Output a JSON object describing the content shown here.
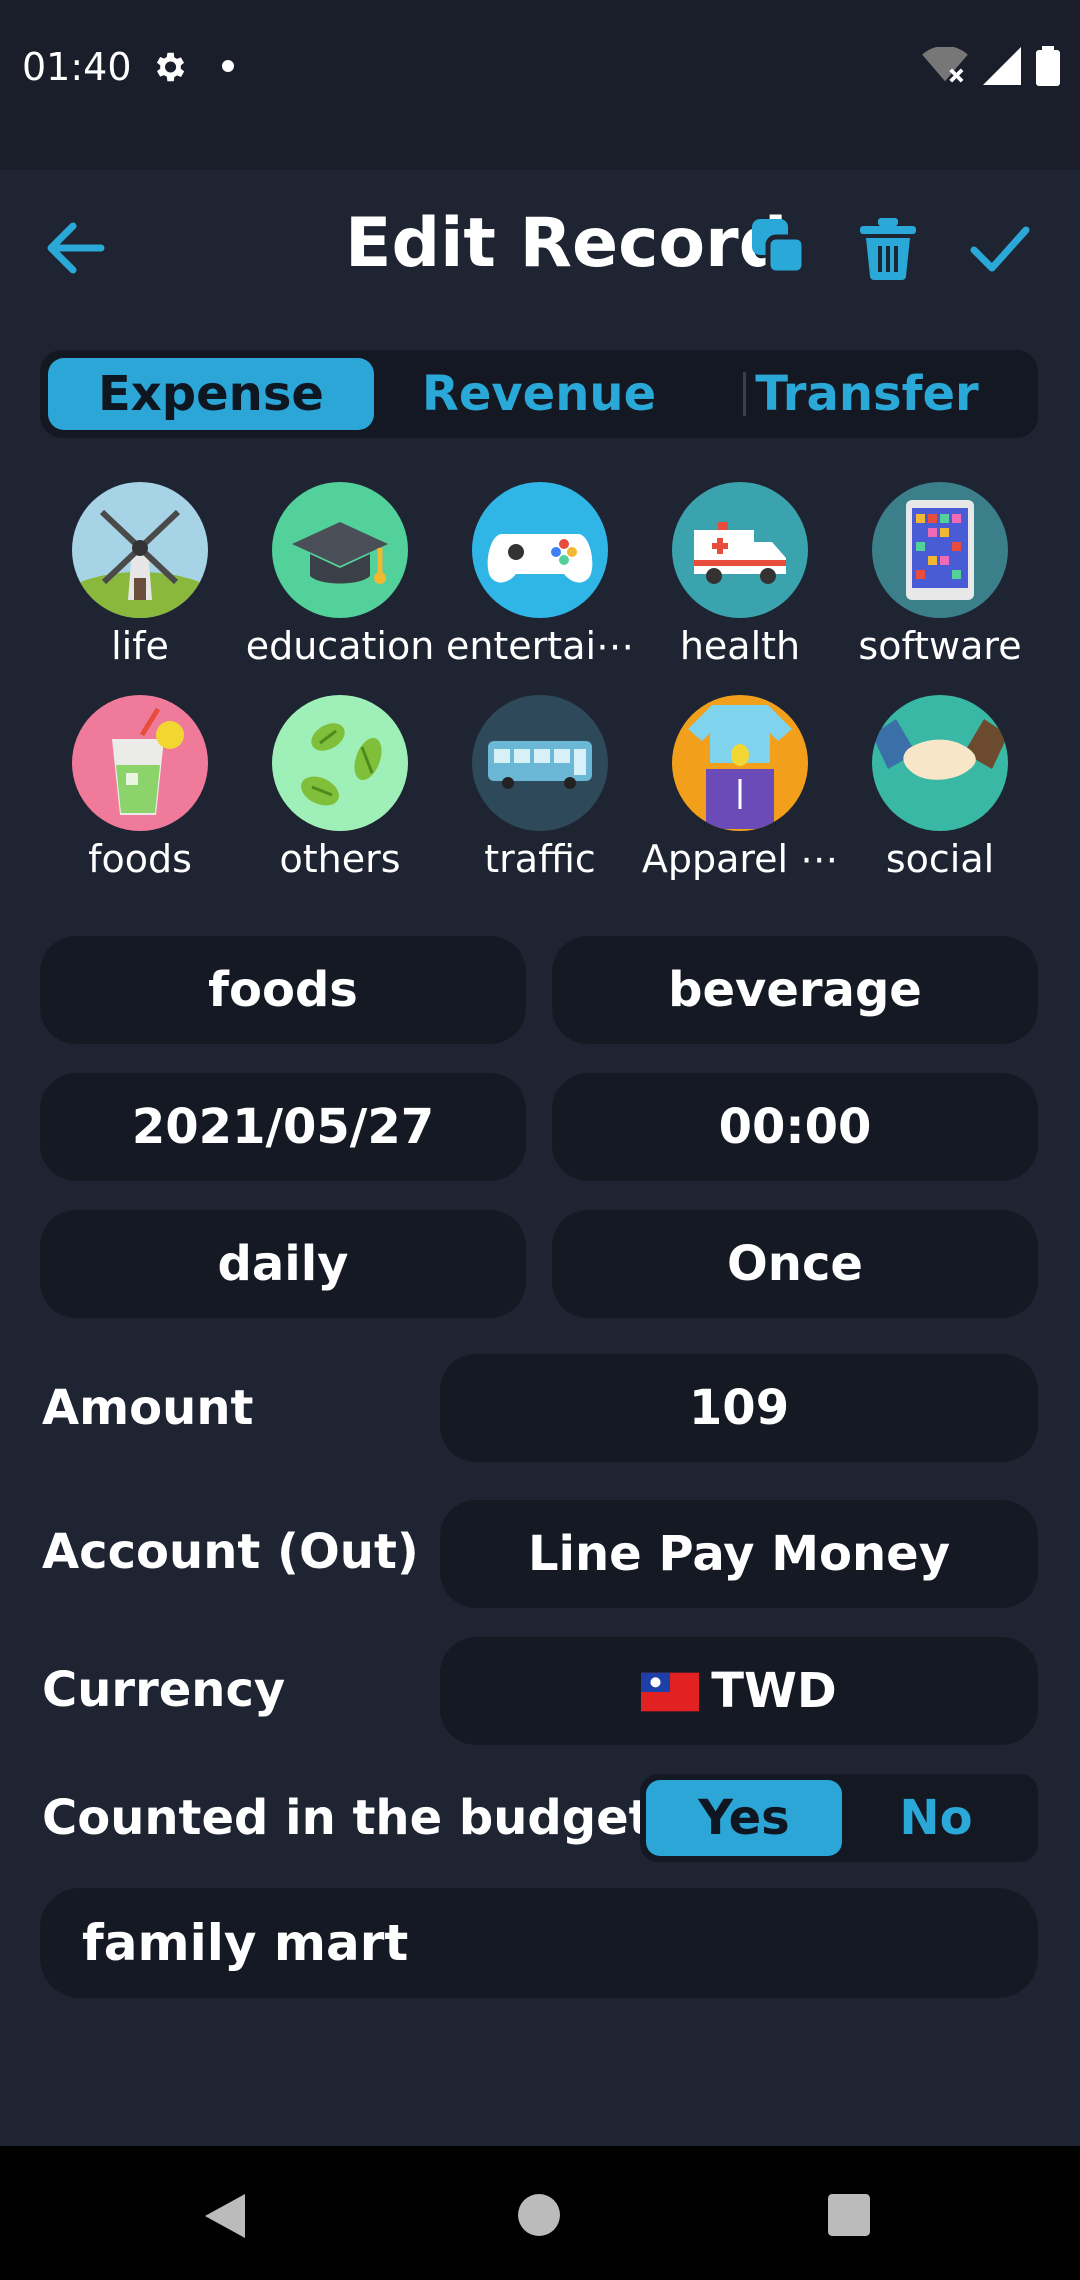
{
  "status": {
    "time": "01:40"
  },
  "header": {
    "title": "Edit Record"
  },
  "tabs": [
    {
      "label": "Expense",
      "active": true
    },
    {
      "label": "Revenue",
      "active": false
    },
    {
      "label": "Transfer",
      "active": false
    }
  ],
  "categories": [
    {
      "label": "life",
      "icon": "windmill-icon"
    },
    {
      "label": "education",
      "icon": "graduation-cap-icon"
    },
    {
      "label": "entertai⋯",
      "icon": "gamepad-icon"
    },
    {
      "label": "health",
      "icon": "ambulance-icon"
    },
    {
      "label": "software",
      "icon": "tablet-icon"
    },
    {
      "label": "foods",
      "icon": "drink-icon"
    },
    {
      "label": "others",
      "icon": "leaves-icon"
    },
    {
      "label": "traffic",
      "icon": "bus-icon"
    },
    {
      "label": "Apparel ⋯",
      "icon": "clothes-icon"
    },
    {
      "label": "social",
      "icon": "handshake-icon"
    }
  ],
  "fields": {
    "category": "foods",
    "subcategory": "beverage",
    "date": "2021/05/27",
    "time": "00:00",
    "frequency": "daily",
    "repeat": "Once"
  },
  "amount": {
    "label": "Amount",
    "value": "109"
  },
  "account": {
    "label": "Account (Out)",
    "value": "Line Pay Money"
  },
  "currency": {
    "label": "Currency",
    "value": "TWD",
    "flag": "taiwan-flag-icon"
  },
  "budget": {
    "label": "Counted in the budget",
    "yes": "Yes",
    "no": "No",
    "selected": "Yes"
  },
  "note": {
    "value": "family mart"
  },
  "colors": {
    "accent": "#2ca6d6",
    "background": "#1f2432",
    "field": "#151923"
  }
}
